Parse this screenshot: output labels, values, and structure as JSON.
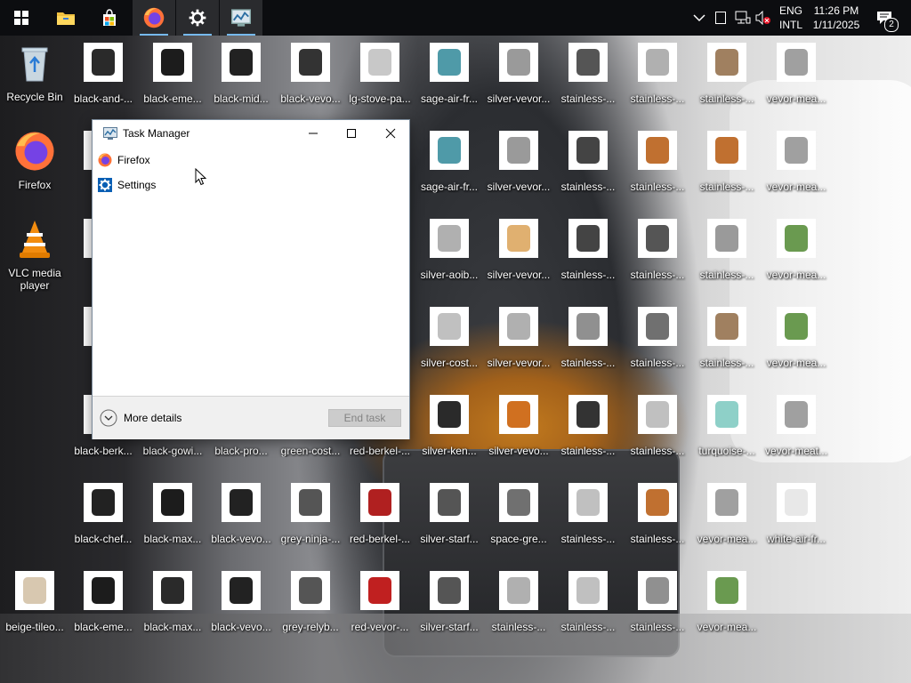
{
  "taskbar": {
    "apps": [
      {
        "name": "start",
        "icon": "windows-logo-icon"
      },
      {
        "name": "file-explorer",
        "icon": "folder-icon"
      },
      {
        "name": "store",
        "icon": "store-bag-icon"
      },
      {
        "name": "firefox",
        "icon": "firefox-icon"
      },
      {
        "name": "settings",
        "icon": "gear-icon"
      },
      {
        "name": "task-manager",
        "icon": "task-manager-icon"
      }
    ],
    "language": {
      "line1": "ENG",
      "line2": "INTL"
    },
    "clock": {
      "time": "11:26 PM",
      "date": "1/11/2025"
    },
    "notification_count": "2"
  },
  "desktop": {
    "icons": [
      {
        "label": "Recycle Bin",
        "type": "recycle-bin-icon"
      },
      {
        "label": "black-and-...",
        "color": "#2a2a2a"
      },
      {
        "label": "black-eme...",
        "color": "#1c1c1c"
      },
      {
        "label": "black-mid...",
        "color": "#222222"
      },
      {
        "label": "black-vevo...",
        "color": "#333333"
      },
      {
        "label": "lg-stove-pa...",
        "color": "#c8c8c8"
      },
      {
        "label": "sage-air-fr...",
        "color": "#4f9aa8"
      },
      {
        "label": "silver-vevor...",
        "color": "#9a9a9a"
      },
      {
        "label": "stainless-...",
        "color": "#555555"
      },
      {
        "label": "stainless-...",
        "color": "#b0b0b0"
      },
      {
        "label": "stainless-...",
        "color": "#a08060"
      },
      {
        "label": "vevor-mea...",
        "color": "#a0a0a0"
      },
      {
        "label": "Firefox",
        "type": "firefox-icon"
      },
      {
        "label": "blac",
        "color": "#222222"
      },
      {
        "label": "sage-air-fr...",
        "color": "#4f9aa8"
      },
      {
        "label": "silver-vevor...",
        "color": "#9a9a9a"
      },
      {
        "label": "stainless-...",
        "color": "#444444"
      },
      {
        "label": "stainless-...",
        "color": "#c07030"
      },
      {
        "label": "stainless-...",
        "color": "#c07030"
      },
      {
        "label": "vevor-mea...",
        "color": "#a0a0a0"
      },
      {
        "label": "VLC media player",
        "type": "vlc-icon"
      },
      {
        "label": "blac",
        "color": "#222222"
      },
      {
        "label": "silver-aoib...",
        "color": "#b0b0b0"
      },
      {
        "label": "silver-vevor...",
        "color": "#e0b070"
      },
      {
        "label": "stainless-...",
        "color": "#444444"
      },
      {
        "label": "stainless-...",
        "color": "#555555"
      },
      {
        "label": "stainless-...",
        "color": "#9a9a9a"
      },
      {
        "label": "vevor-mea...",
        "color": "#6a9a50"
      },
      {
        "label": "blac",
        "color": "#222222"
      },
      {
        "label": "silver-cost...",
        "color": "#c0c0c0"
      },
      {
        "label": "silver-vevor...",
        "color": "#b0b0b0"
      },
      {
        "label": "stainless-...",
        "color": "#909090"
      },
      {
        "label": "stainless-...",
        "color": "#707070"
      },
      {
        "label": "stainless-...",
        "color": "#a08060"
      },
      {
        "label": "vevor-mea...",
        "color": "#6a9a50"
      },
      {
        "label": "black-berk...",
        "color": "#222222"
      },
      {
        "label": "black-gowi...",
        "color": "#222222"
      },
      {
        "label": "black-pro...",
        "color": "#222222"
      },
      {
        "label": "green-cost...",
        "color": "#4a7a50"
      },
      {
        "label": "red-berkel-...",
        "color": "#b02020"
      },
      {
        "label": "silver-ken...",
        "color": "#2a2a2a"
      },
      {
        "label": "silver-vevo...",
        "color": "#d07020"
      },
      {
        "label": "stainless-...",
        "color": "#333333"
      },
      {
        "label": "stainless-...",
        "color": "#c0c0c0"
      },
      {
        "label": "turquoise-...",
        "color": "#8ed0c8"
      },
      {
        "label": "vevor-meat...",
        "color": "#a0a0a0"
      },
      {
        "label": "black-chef...",
        "color": "#222222"
      },
      {
        "label": "black-max...",
        "color": "#1c1c1c"
      },
      {
        "label": "black-vevo...",
        "color": "#222222"
      },
      {
        "label": "grey-ninja-...",
        "color": "#555555"
      },
      {
        "label": "red-berkel-...",
        "color": "#b02020"
      },
      {
        "label": "silver-starf...",
        "color": "#555555"
      },
      {
        "label": "space-gre...",
        "color": "#707070"
      },
      {
        "label": "stainless-...",
        "color": "#c0c0c0"
      },
      {
        "label": "stainless-...",
        "color": "#c07030"
      },
      {
        "label": "vevor-mea...",
        "color": "#a0a0a0"
      },
      {
        "label": "white-air-fr...",
        "color": "#e8e8e8"
      },
      {
        "label": "beige-tileo...",
        "color": "#d8c8b0"
      },
      {
        "label": "black-eme...",
        "color": "#1c1c1c"
      },
      {
        "label": "black-max...",
        "color": "#2a2a2a"
      },
      {
        "label": "black-vevo...",
        "color": "#222222"
      },
      {
        "label": "grey-relyb...",
        "color": "#555555"
      },
      {
        "label": "red-vevor-...",
        "color": "#c02020"
      },
      {
        "label": "silver-starf...",
        "color": "#555555"
      },
      {
        "label": "stainless-...",
        "color": "#b0b0b0"
      },
      {
        "label": "stainless-...",
        "color": "#c0c0c0"
      },
      {
        "label": "stainless-...",
        "color": "#909090"
      },
      {
        "label": "vevor-mea...",
        "color": "#6a9a50"
      }
    ]
  },
  "task_manager": {
    "title": "Task Manager",
    "apps": [
      {
        "label": "Firefox",
        "icon": "firefox-icon"
      },
      {
        "label": "Settings",
        "icon": "gear-icon"
      }
    ],
    "more_details": "More details",
    "end_task": "End task"
  }
}
